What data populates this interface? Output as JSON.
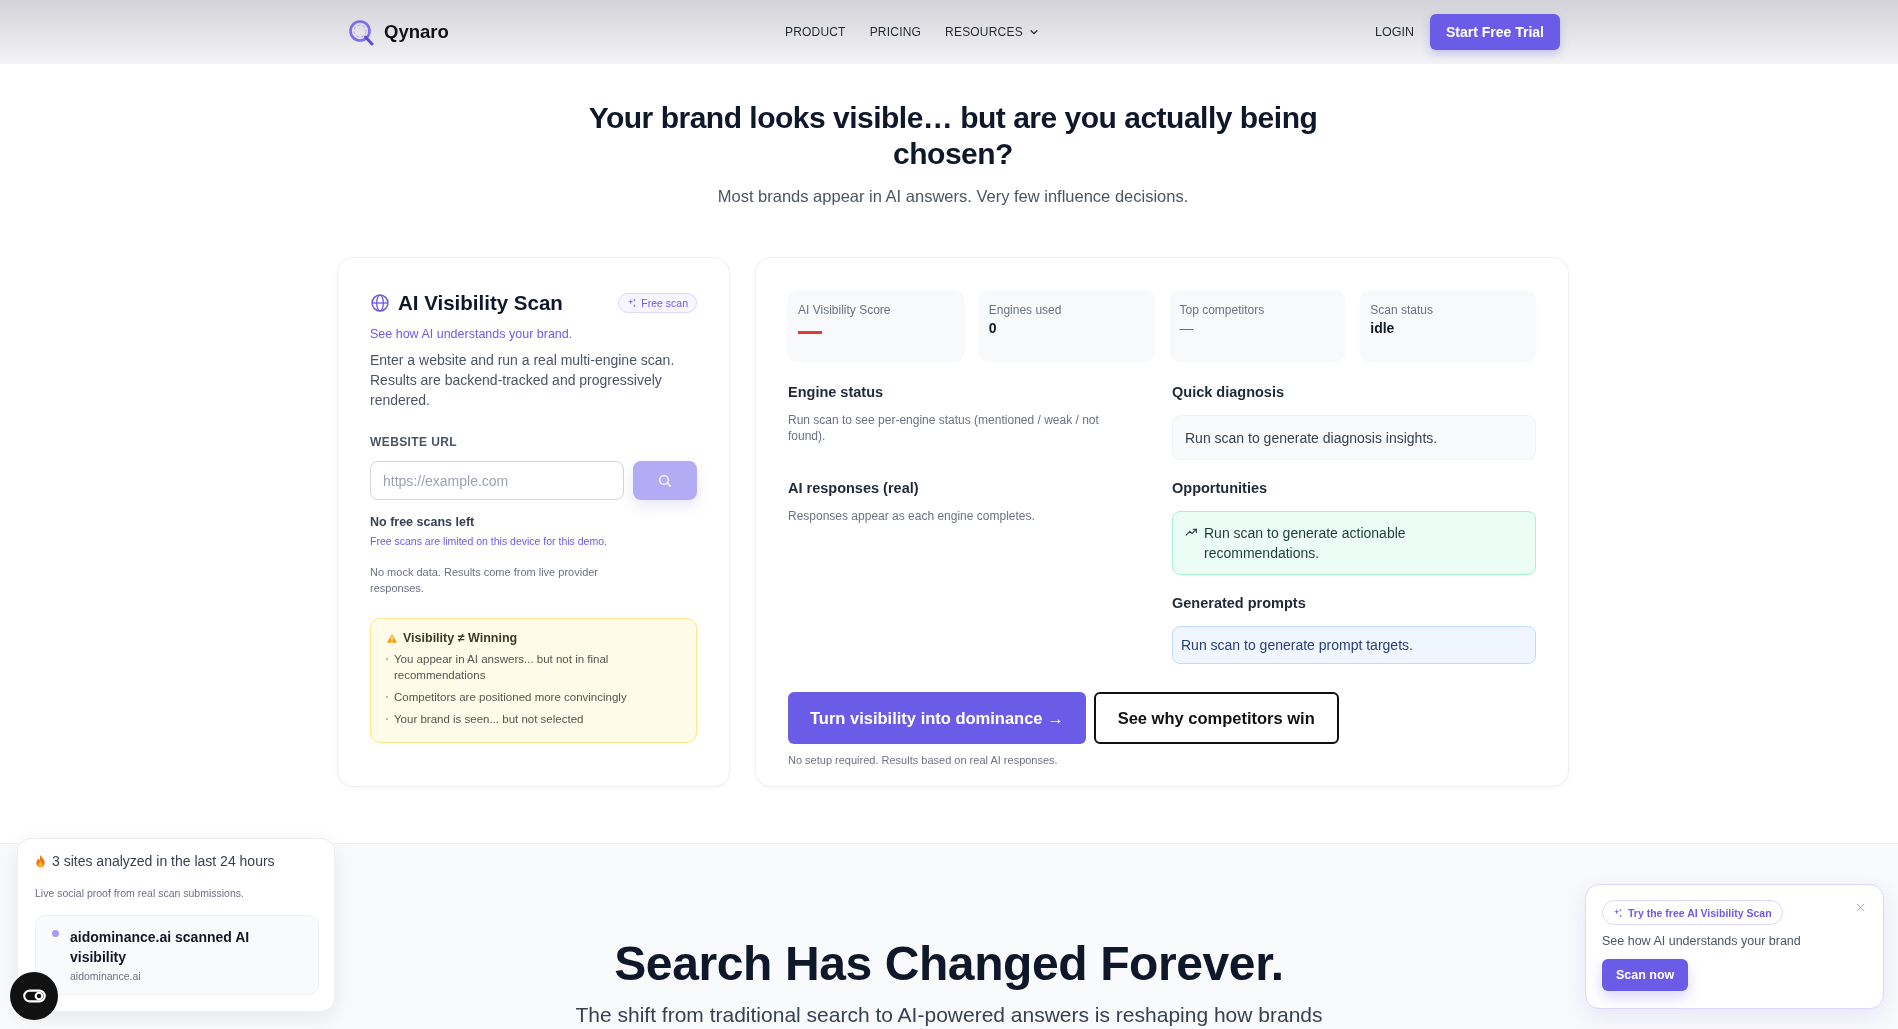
{
  "header": {
    "brand": "Qynaro",
    "nav": [
      {
        "label": "PRODUCT",
        "dropdown": false
      },
      {
        "label": "PRICING",
        "dropdown": false
      },
      {
        "label": "RESOURCES",
        "dropdown": true
      }
    ],
    "login": "LOGIN",
    "cta": "Start Free Trial"
  },
  "hero": {
    "title": "Your brand looks visible… but are you actually being chosen?",
    "subtitle": "Most brands appear in AI answers. Very few influence decisions."
  },
  "scan_card": {
    "title": "AI Visibility Scan",
    "badge": "Free scan",
    "tagline": "See how AI understands your brand.",
    "description": "Enter a website and run a real multi-engine scan. Results are backend-tracked and progressively rendered.",
    "url_label": "WEBSITE URL",
    "url_field": {
      "placeholder": "https://example.com"
    },
    "search_button": {
      "disabled": true
    },
    "limit_title": "No free scans left",
    "limit_note": "Free scans are limited on this device for this demo.",
    "data_note": "No mock data. Results come from live provider responses.",
    "warning": {
      "title": "Visibility ≠ Winning",
      "items": [
        "You appear in AI answers... but not in final recommendations",
        "Competitors are positioned more convincingly",
        "Your brand is seen... but not selected"
      ]
    }
  },
  "results_card": {
    "stats": [
      {
        "label": "AI Visibility Score",
        "kind": "pending"
      },
      {
        "label": "Engines used",
        "kind": "value",
        "value": "0"
      },
      {
        "label": "Top competitors",
        "kind": "empty",
        "value": "—"
      },
      {
        "label": "Scan status",
        "kind": "value",
        "value": "idle"
      }
    ],
    "left_column": [
      {
        "title": "Engine status",
        "kind": "note",
        "text": "Run scan to see per-engine status (mentioned / weak / not found)."
      },
      {
        "title": "AI responses (real)",
        "kind": "note",
        "text": "Responses appear as each engine completes."
      }
    ],
    "right_column": [
      {
        "title": "Quick diagnosis",
        "kind": "box",
        "text": "Run scan to generate diagnosis insights."
      },
      {
        "title": "Opportunities",
        "kind": "success",
        "text": "Run scan to generate actionable recommendations."
      },
      {
        "title": "Generated prompts",
        "kind": "info",
        "text": "Run scan to generate prompt targets."
      }
    ],
    "actions": [
      {
        "label": "Turn visibility into dominance →",
        "kind": "primary"
      },
      {
        "label": "See why competitors win",
        "kind": "secondary"
      }
    ],
    "footnote": "No setup required. Results based on real AI responses."
  },
  "next_section": {
    "title": "Search Has Changed Forever.",
    "subtitle": "The shift from traditional search to AI-powered answers is reshaping how brands"
  },
  "social_proof": {
    "headline": "3 sites analyzed in the last 24 hours",
    "note": "Live social proof from real scan submissions.",
    "items": [
      {
        "title": "aidominance.ai scanned AI visibility",
        "domain": "aidominance.ai"
      }
    ]
  },
  "promo": {
    "badge": "Try the free AI Visibility Scan",
    "text": "See how AI understands your brand",
    "button": "Scan now"
  }
}
